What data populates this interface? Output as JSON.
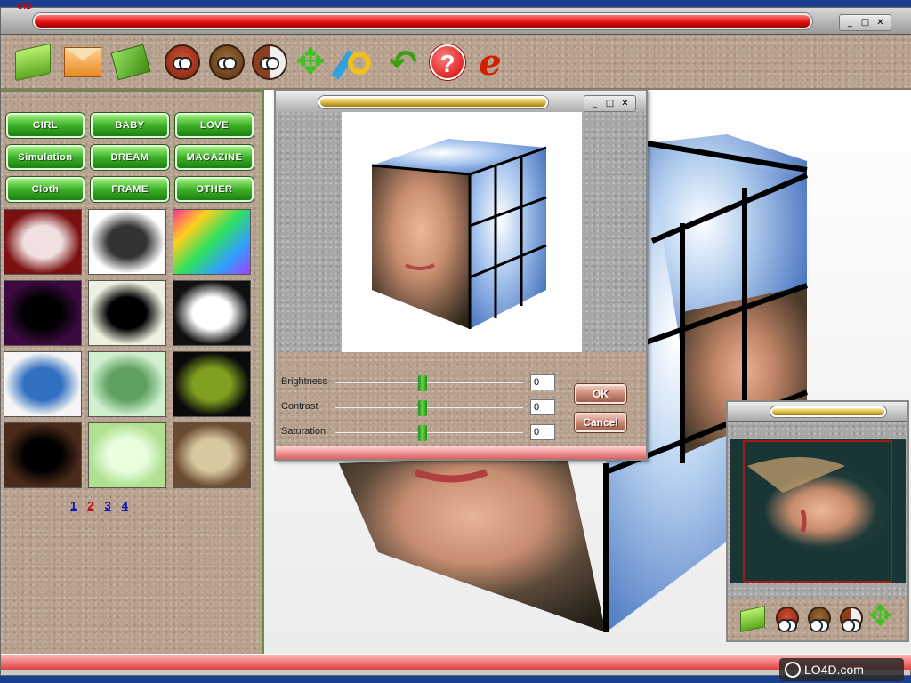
{
  "window": {
    "title": "",
    "controls": [
      "_",
      "□",
      "✕"
    ]
  },
  "app_logo": "CID",
  "toolbar": {
    "items": [
      {
        "name": "open-folder",
        "icon": "folder-icon"
      },
      {
        "name": "save",
        "icon": "envelope-icon"
      },
      {
        "name": "edit-photo",
        "icon": "photo-edit-icon"
      },
      {
        "name": "effect-owl-1",
        "icon": "owl-icon"
      },
      {
        "name": "effect-owl-2",
        "icon": "owl-icon"
      },
      {
        "name": "effect-owl-3",
        "icon": "owl-half-icon"
      },
      {
        "name": "move",
        "icon": "move-arrows-icon"
      },
      {
        "name": "brush",
        "icon": "brush-icon"
      },
      {
        "name": "undo",
        "icon": "undo-icon"
      },
      {
        "name": "help",
        "icon": "help-icon"
      },
      {
        "name": "web",
        "icon": "ie-icon"
      }
    ]
  },
  "categories": [
    "GIRL",
    "BABY",
    "LOVE",
    "Simulation",
    "DREAM",
    "MAGAZINE",
    "Cloth",
    "FRAME",
    "OTHER"
  ],
  "thumbnails": [
    {
      "name": "red-flower-frame",
      "colors": [
        "#7a1010",
        "#f0e0e0"
      ]
    },
    {
      "name": "ink-bird-frame",
      "colors": [
        "#ffffff",
        "#333333"
      ]
    },
    {
      "name": "rainbow-gradient",
      "colors": [
        "#ff40a0",
        "#40ff80"
      ]
    },
    {
      "name": "purple-collage",
      "colors": [
        "#3a0a40",
        "#000000"
      ]
    },
    {
      "name": "black-squares-collage",
      "colors": [
        "#f0f0e0",
        "#000000"
      ]
    },
    {
      "name": "white-panels",
      "colors": [
        "#101010",
        "#ffffff"
      ]
    },
    {
      "name": "3d-cube",
      "colors": [
        "#f5f5f5",
        "#3070c0"
      ]
    },
    {
      "name": "green-floral",
      "colors": [
        "#d0f0d0",
        "#60a060"
      ]
    },
    {
      "name": "dark-flower-frame",
      "colors": [
        "#0a0a0a",
        "#80a020"
      ]
    },
    {
      "name": "brown-black",
      "colors": [
        "#4a2a1a",
        "#000000"
      ]
    },
    {
      "name": "green-bokeh",
      "colors": [
        "#b0e090",
        "#e8ffe0"
      ]
    },
    {
      "name": "parchment",
      "colors": [
        "#6a4a30",
        "#d8c8a0"
      ]
    }
  ],
  "pager": {
    "pages": [
      "1",
      "2",
      "3",
      "4"
    ],
    "current": "2"
  },
  "adjust_dialog": {
    "controls": [
      "_",
      "□",
      "✕"
    ],
    "sliders": [
      {
        "label": "Brightness",
        "value": "0"
      },
      {
        "label": "Contrast",
        "value": "0"
      },
      {
        "label": "Saturation",
        "value": "0"
      }
    ],
    "ok_label": "OK",
    "cancel_label": "Cancel"
  },
  "mini_preview": {
    "toolbar": [
      "folder-icon",
      "owl-icon",
      "owl-icon",
      "owl-half-icon",
      "move-arrows-icon"
    ]
  },
  "watermark": "LO4D.com",
  "colors": {
    "accent_red": "#e01010",
    "button_green": "#3cb028",
    "panel_granite": "#b49e8c",
    "sky_blue": "#6c98d8"
  }
}
